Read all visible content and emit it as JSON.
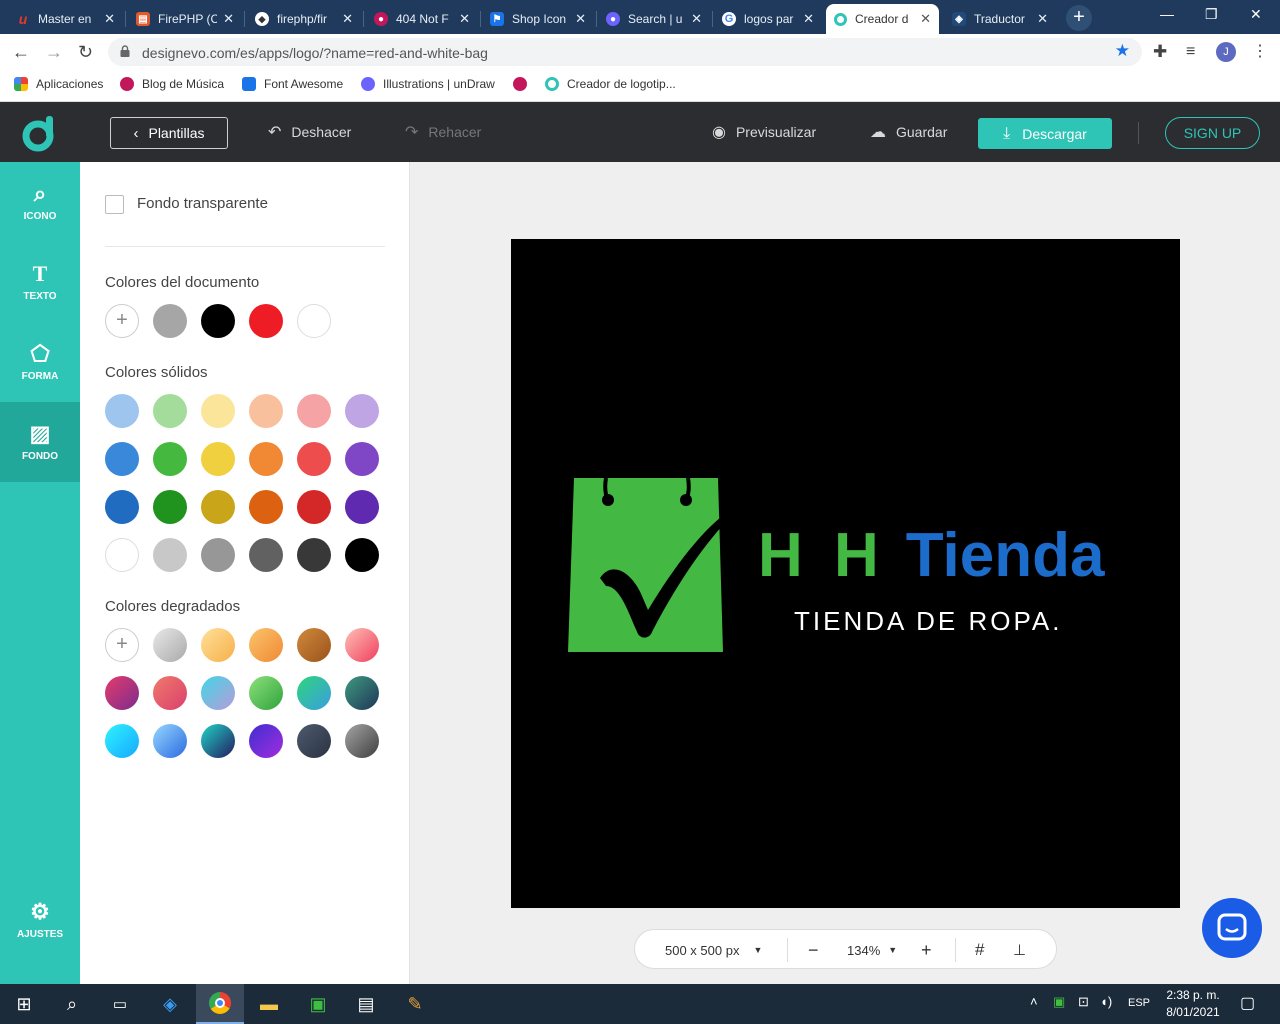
{
  "browser": {
    "tabs": [
      {
        "title": "Master en",
        "icon": "udemy-icon",
        "color": "#a435f0"
      },
      {
        "title": "FirePHP (C",
        "icon": "firephp-icon",
        "color": "#e25a2c"
      },
      {
        "title": "firephp/fir",
        "icon": "github-icon",
        "color": "#ffffff"
      },
      {
        "title": "404 Not F",
        "icon": "dribbble-icon",
        "color": "#c2185b"
      },
      {
        "title": "Shop Icon",
        "icon": "fontawesome-flag-icon",
        "color": "#1a73e8"
      },
      {
        "title": "Search | u",
        "icon": "undraw-icon",
        "color": "#6c63ff"
      },
      {
        "title": "logos par",
        "icon": "google-icon",
        "color": "#ffffff"
      },
      {
        "title": "Creador d",
        "icon": "designevo-icon",
        "color": "#2ec4b6"
      },
      {
        "title": "Traductor",
        "icon": "translator-icon",
        "color": "#1f4a7a"
      }
    ],
    "url": "designevo.com/es/apps/logo/?name=red-and-white-bag",
    "profile_initial": "J",
    "bookmarks": [
      {
        "label": "Aplicaciones",
        "icon": "apps-grid-icon"
      },
      {
        "label": "Blog de Música",
        "icon": "dribbble-icon"
      },
      {
        "label": "Font Awesome",
        "icon": "fontawesome-flag-icon"
      },
      {
        "label": "Illustrations | unDraw",
        "icon": "undraw-icon"
      },
      {
        "label": "",
        "icon": "dribbble-icon"
      },
      {
        "label": "Creador de logotip...",
        "icon": "designevo-icon"
      }
    ]
  },
  "toolbar": {
    "templates_label": "Plantillas",
    "undo_label": "Deshacer",
    "redo_label": "Rehacer",
    "preview_label": "Previsualizar",
    "save_label": "Guardar",
    "download_label": "Descargar",
    "signup_label": "SIGN UP"
  },
  "sidebar": {
    "items": [
      {
        "label": "ICONO",
        "icon": "search-icon"
      },
      {
        "label": "TEXTO",
        "icon": "text-icon"
      },
      {
        "label": "FORMA",
        "icon": "shape-icon"
      },
      {
        "label": "FONDO",
        "icon": "background-icon",
        "active": true
      },
      {
        "label": "AJUSTES",
        "icon": "gear-icon"
      }
    ]
  },
  "panel": {
    "transparent_label": "Fondo transparente",
    "doc_colors_title": "Colores del documento",
    "doc_colors": [
      "#a6a6a6",
      "#000000",
      "#ee1c25",
      "#ffffff"
    ],
    "solid_title": "Colores sólidos",
    "solid_colors": [
      [
        "#9ec5ee",
        "#a3dc9b",
        "#fbe59b",
        "#f9c09e",
        "#f5a3a5",
        "#bfa5e4"
      ],
      [
        "#3a88da",
        "#45b93f",
        "#f1d03f",
        "#f08834",
        "#ed4d4d",
        "#7f46c6"
      ],
      [
        "#1f6cc1",
        "#1f931e",
        "#c9a51a",
        "#dc6110",
        "#d42727",
        "#5f2ab0"
      ],
      [
        "#ffffff",
        "#c8c8c8",
        "#979797",
        "#616161",
        "#383838",
        "#000000"
      ]
    ],
    "gradient_title": "Colores degradados",
    "gradients": [
      [
        null,
        [
          "#e9e9e9",
          "#a9a9a9"
        ],
        [
          "#ffe09a",
          "#f6b04a"
        ],
        [
          "#fbc46b",
          "#ef8a34"
        ],
        [
          "#d08a3c",
          "#9a531b"
        ],
        [
          "#ffc1b5",
          "#ef3e5e"
        ]
      ],
      [
        [
          "#e53b6b",
          "#7b2d8d"
        ],
        [
          "#f07a6a",
          "#d9406e"
        ],
        [
          "#42d6e6",
          "#b79bd9"
        ],
        [
          "#8de07a",
          "#2fa33c"
        ],
        [
          "#2fd47c",
          "#3a9ee0"
        ],
        [
          "#3f9a80",
          "#1e3557"
        ]
      ],
      [
        [
          "#2ff3ff",
          "#16a8ff"
        ],
        [
          "#97d7ff",
          "#2a6be0"
        ],
        [
          "#20d4c8",
          "#231a5e"
        ],
        [
          "#3f2ecf",
          "#a12de0"
        ],
        [
          "#4d5a6e",
          "#2a3342"
        ],
        [
          "#a5a5a5",
          "#3e3e3e"
        ]
      ]
    ]
  },
  "logo": {
    "brand_part1": "H H",
    "brand_part2": "Tienda",
    "tagline": "TIENDA DE ROPA.",
    "green": "#43b842",
    "blue": "#1c6ccc"
  },
  "zoom": {
    "size_label": "500 x 500 px",
    "zoom_label": "134%"
  },
  "taskbar": {
    "time": "2:38 p. m.",
    "date": "8/01/2021",
    "lang": "ESP"
  }
}
